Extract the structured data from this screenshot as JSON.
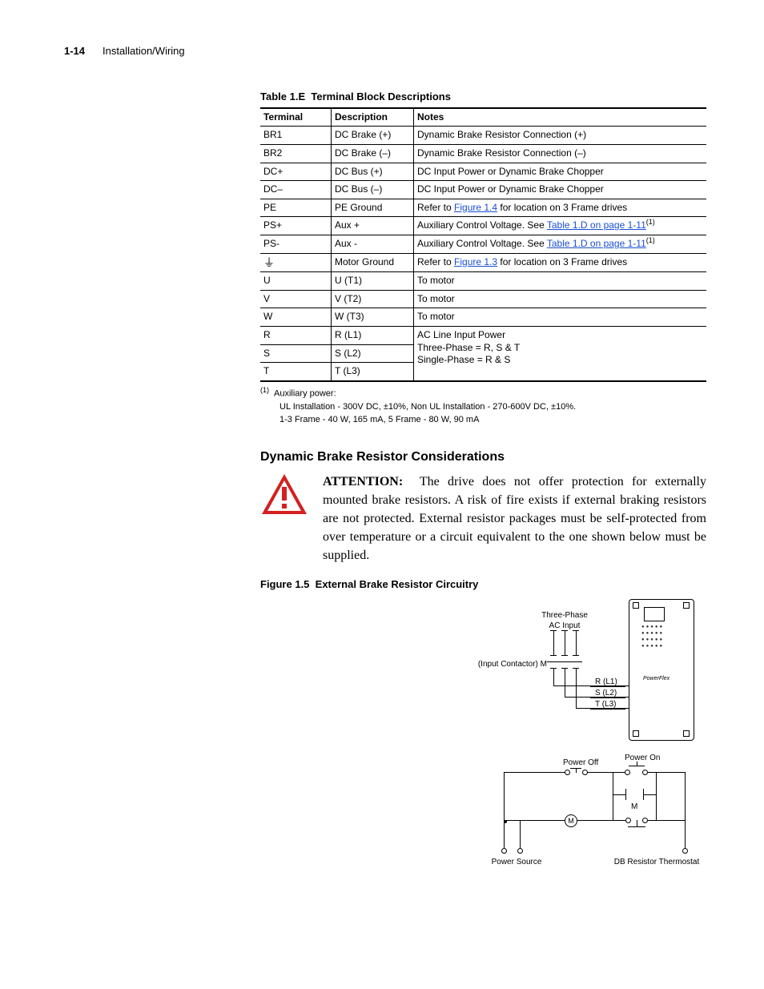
{
  "header": {
    "page_num": "1-14",
    "section": "Installation/Wiring"
  },
  "table": {
    "caption_label": "Table 1.E",
    "caption_title": "Terminal Block Descriptions",
    "headers": {
      "c1": "Terminal",
      "c2": "Description",
      "c3": "Notes"
    },
    "rows": [
      {
        "t": "BR1",
        "d": "DC Brake (+)",
        "n": "Dynamic Brake Resistor Connection (+)"
      },
      {
        "t": "BR2",
        "d": "DC Brake (–)",
        "n": "Dynamic Brake Resistor Connection (–)"
      },
      {
        "t": "DC+",
        "d": "DC Bus (+)",
        "n": "DC Input Power or Dynamic Brake Chopper"
      },
      {
        "t": "DC–",
        "d": "DC Bus (–)",
        "n": "DC Input Power or Dynamic Brake Chopper"
      },
      {
        "t": "PE",
        "d": "PE Ground",
        "n_pre": "Refer to ",
        "link": "Figure 1.4",
        "n_post": " for location on 3 Frame drives"
      },
      {
        "t": "PS+",
        "d": "Aux +",
        "n_pre": "Auxiliary Control Voltage. See ",
        "link": "Table 1.D on page 1-11",
        "sup": "(1)"
      },
      {
        "t": "PS-",
        "d": "Aux -",
        "n_pre": "Auxiliary Control Voltage. See ",
        "link": "Table 1.D on page 1-11",
        "sup": "(1)"
      },
      {
        "t": "⏚",
        "d": "Motor Ground",
        "n_pre": "Refer to ",
        "link": "Figure 1.3",
        "n_post": " for location on 3 Frame drives"
      },
      {
        "t": "U",
        "d": "U (T1)",
        "n": "To motor"
      },
      {
        "t": "V",
        "d": "V (T2)",
        "n": "To motor"
      },
      {
        "t": "W",
        "d": "W (T3)",
        "n": "To motor"
      },
      {
        "t": "R",
        "d": "R (L1)"
      },
      {
        "t": "S",
        "d": "S (L2)"
      },
      {
        "t": "T",
        "d": "T (L3)"
      }
    ],
    "merged_note_line1": "AC Line Input Power",
    "merged_note_line2": "Three-Phase = R, S & T",
    "merged_note_line3": "Single-Phase = R & S"
  },
  "footnote": {
    "marker": "(1)",
    "line1": "Auxiliary power:",
    "line2": "UL Installation - 300V DC,  ±10%, Non UL Installation - 270-600V DC,  ±10%.",
    "line3": "1-3 Frame - 40 W, 165 mA, 5 Frame - 80 W, 90 mA"
  },
  "section_heading": "Dynamic Brake Resistor Considerations",
  "attention": {
    "label": "ATTENTION:",
    "body": "The drive does not offer protection for externally mounted brake resistors. A risk of fire exists if external braking resistors are not protected. External resistor packages must be self-protected from over temperature or a circuit equivalent to the one shown below must be supplied."
  },
  "figure": {
    "caption_label": "Figure 1.5",
    "caption_title": "External Brake Resistor Circuitry",
    "labels": {
      "three_phase": "Three-Phase",
      "ac_input": "AC Input",
      "input_contactor": "(Input Contactor) M",
      "r_l1": "R (L1)",
      "s_l2": "S (L2)",
      "t_l3": "T (L3)",
      "power_off": "Power Off",
      "power_on": "Power On",
      "m_label": "M",
      "power_source": "Power Source",
      "db_therm": "DB Resistor Thermostat",
      "brand": "PowerFlex"
    }
  }
}
